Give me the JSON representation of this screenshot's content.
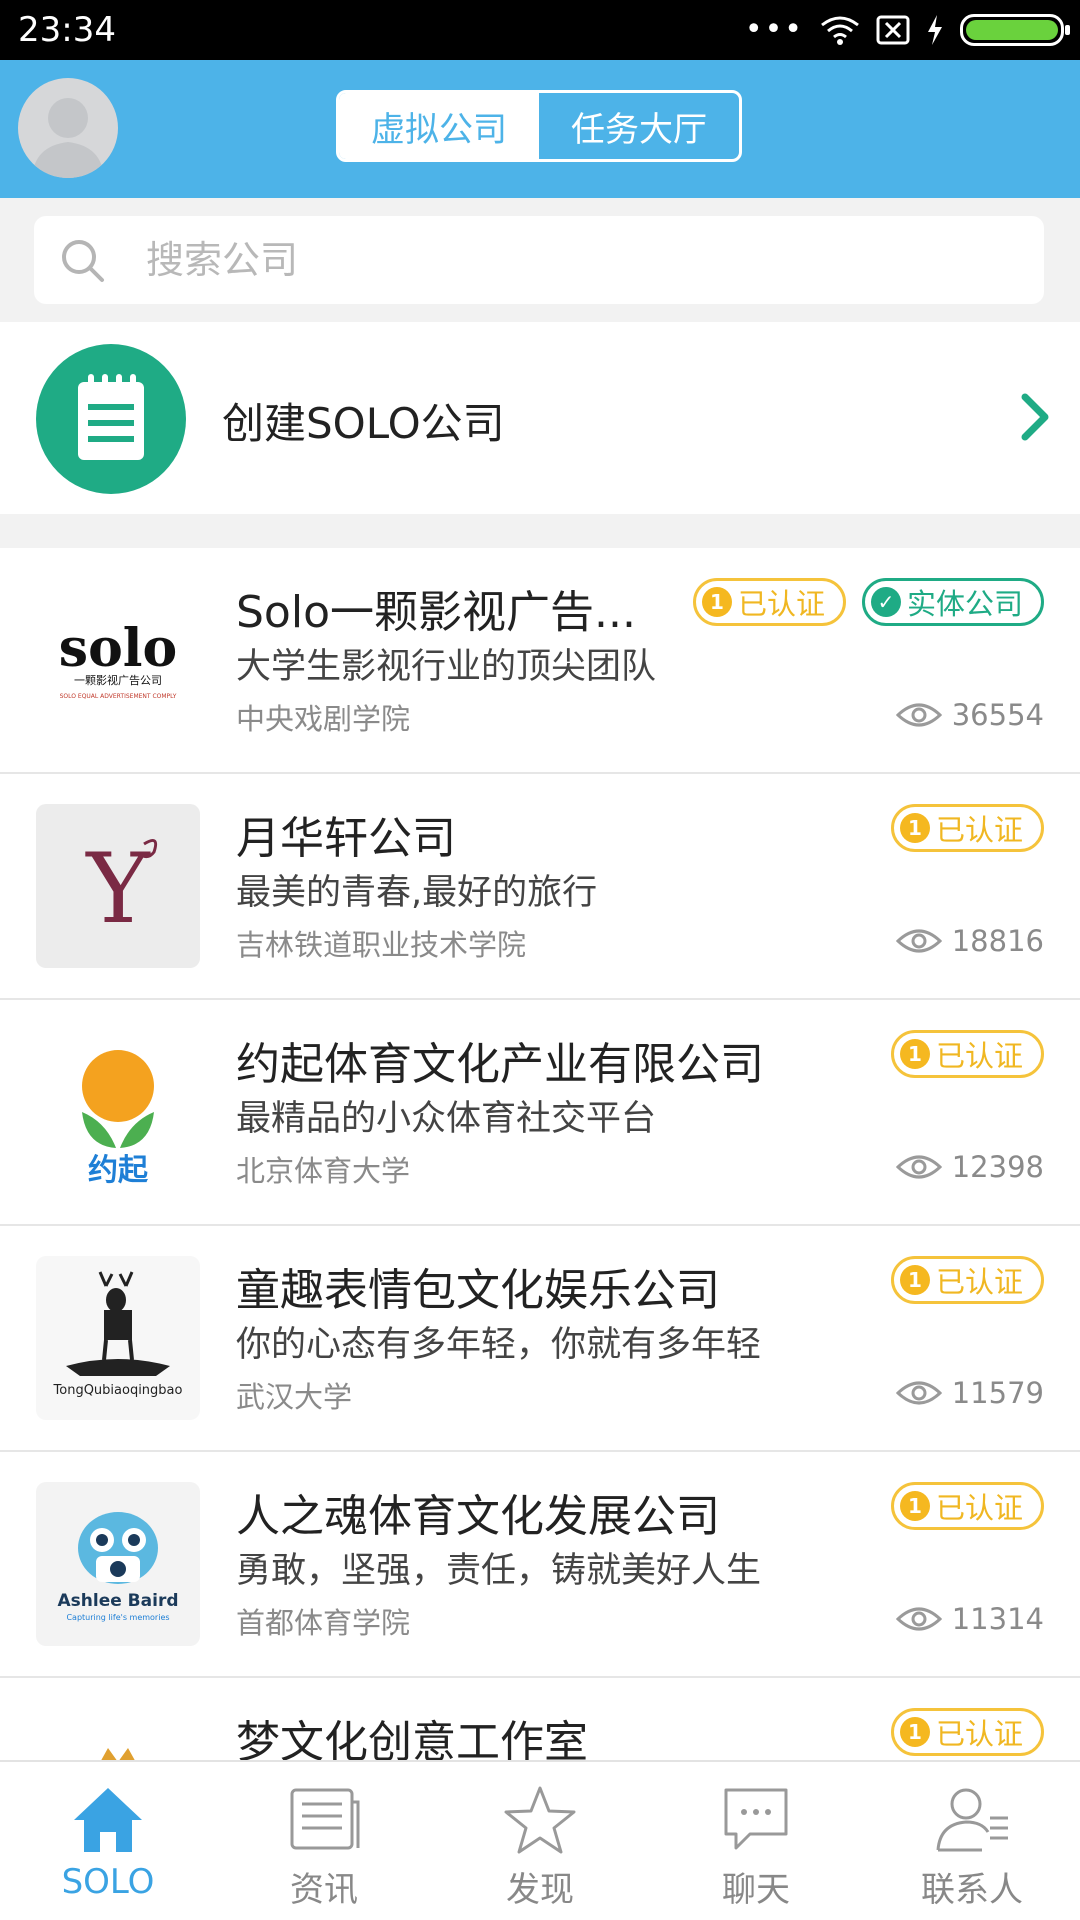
{
  "status_bar": {
    "time": "23:34",
    "dots": "•••"
  },
  "header": {
    "tabs": [
      {
        "label": "虚拟公司",
        "active": true
      },
      {
        "label": "任务大厅",
        "active": false
      }
    ]
  },
  "search": {
    "placeholder": "搜索公司"
  },
  "create": {
    "label": "创建SOLO公司",
    "icon": "notepad-icon"
  },
  "companies": [
    {
      "name": "Solo一颗影视广告...",
      "slogan": "大学生影视行业的顶尖团队",
      "school": "中央戏剧学院",
      "views": "36554",
      "badges": [
        "已认证",
        "实体公司"
      ]
    },
    {
      "name": "月华轩公司",
      "slogan": "最美的青春,最好的旅行",
      "school": "吉林铁道职业技术学院",
      "views": "18816",
      "badges": [
        "已认证"
      ]
    },
    {
      "name": "约起体育文化产业有限公司",
      "slogan": "最精品的小众体育社交平台",
      "school": "北京体育大学",
      "views": "12398",
      "badges": [
        "已认证"
      ]
    },
    {
      "name": "童趣表情包文化娱乐公司",
      "slogan": "你的心态有多年轻，你就有多年轻",
      "school": "武汉大学",
      "views": "11579",
      "badges": [
        "已认证"
      ]
    },
    {
      "name": "人之魂体育文化发展公司",
      "slogan": "勇敢，坚强，责任，铸就美好人生",
      "school": "首都体育学院",
      "views": "11314",
      "badges": [
        "已认证"
      ]
    },
    {
      "name": "梦文化创意工作室",
      "slogan": "",
      "school": "",
      "views": "",
      "badges": [
        "已认证"
      ]
    }
  ],
  "logos": {
    "solo_text": "solo",
    "solo_sub": "一颗影视广告公司",
    "solo_tag": "SOLO EQUAL ADVERTISEMENT COMPLY",
    "yuehua_letter": "Y",
    "yueqi_text": "约起",
    "tongqu_text": "TongQubiaoqingbao",
    "ashlee_text": "Ashlee Baird",
    "ashlee_tag": "Capturing life's memories"
  },
  "tabbar": [
    {
      "label": "SOLO",
      "icon": "home-icon",
      "active": true
    },
    {
      "label": "资讯",
      "icon": "news-icon",
      "active": false
    },
    {
      "label": "发现",
      "icon": "star-icon",
      "active": false
    },
    {
      "label": "聊天",
      "icon": "chat-icon",
      "active": false
    },
    {
      "label": "联系人",
      "icon": "contacts-icon",
      "active": false
    }
  ],
  "colors": {
    "header": "#4db3e8",
    "accent_green": "#1fab85",
    "badge_gold": "#f5c33b",
    "tab_active": "#3aa3e3"
  }
}
